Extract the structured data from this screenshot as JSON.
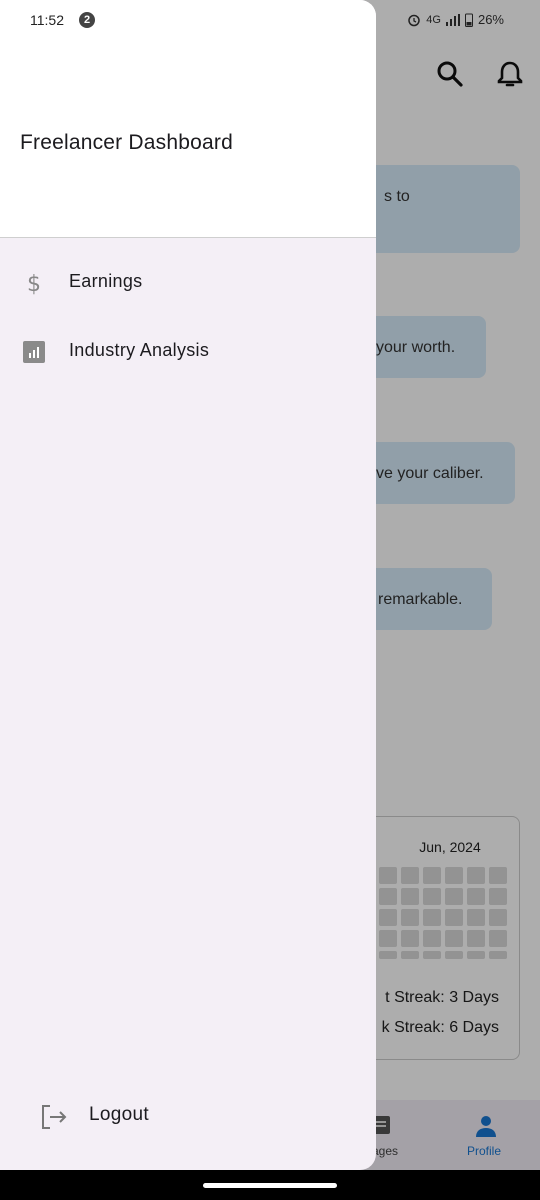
{
  "status_bar": {
    "time": "11:52",
    "notification_count": "2",
    "network": "4G",
    "battery": "26%"
  },
  "drawer": {
    "title": "Freelancer Dashboard",
    "items": [
      {
        "label": "Earnings",
        "icon": "dollar-icon"
      },
      {
        "label": "Industry Analysis",
        "icon": "bar-chart-icon"
      }
    ],
    "logout_label": "Logout"
  },
  "background": {
    "bubbles": [
      {
        "text": "s to"
      },
      {
        "text": "your worth."
      },
      {
        "text": "ve your caliber."
      },
      {
        "text": "remarkable."
      }
    ],
    "calendar": {
      "month": "Jun, 2024",
      "current_streak": "t Streak: 3 Days",
      "best_streak": "k Streak: 6 Days"
    },
    "bottom_nav": {
      "messages_label": "ages",
      "profile_label": "Profile"
    }
  },
  "colors": {
    "accent": "#1976d2",
    "drawer_bg": "#f4eff6",
    "bubble_bg": "#d6eaf9"
  }
}
